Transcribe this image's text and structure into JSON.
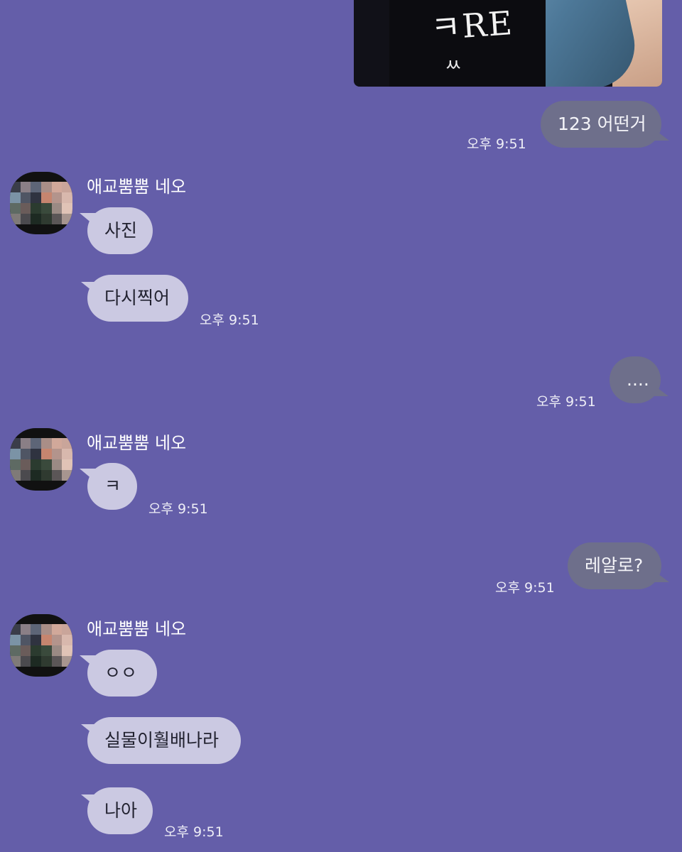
{
  "contact": {
    "name": "애교뿜뿜 네오"
  },
  "colors": {
    "background": "#645ea9",
    "incoming_bubble": "#cbc9e2",
    "outgoing_bubble": "#6e6f8b"
  },
  "shared_photo": {
    "print_text": "ㅋRE",
    "print_small": "ㅆ"
  },
  "messages": [
    {
      "id": 1,
      "direction": "out",
      "text": "123 어떤거",
      "time": "오후 9:51"
    },
    {
      "id": 2,
      "direction": "in",
      "sender": "애교뿜뿜 네오",
      "text": "사진"
    },
    {
      "id": 3,
      "direction": "in",
      "text": "다시찍어",
      "time": "오후 9:51"
    },
    {
      "id": 4,
      "direction": "out",
      "text": "....",
      "time": "오후 9:51"
    },
    {
      "id": 5,
      "direction": "in",
      "sender": "애교뿜뿜 네오",
      "text": "ㅋ",
      "time": "오후 9:51"
    },
    {
      "id": 6,
      "direction": "out",
      "text": "레알로?",
      "time": "오후 9:51"
    },
    {
      "id": 7,
      "direction": "in",
      "sender": "애교뿜뿜 네오",
      "text": "ㅇㅇ"
    },
    {
      "id": 8,
      "direction": "in",
      "text": "실물이훨배나라"
    },
    {
      "id": 9,
      "direction": "in",
      "text": "나아",
      "time": "오후 9:51"
    }
  ]
}
